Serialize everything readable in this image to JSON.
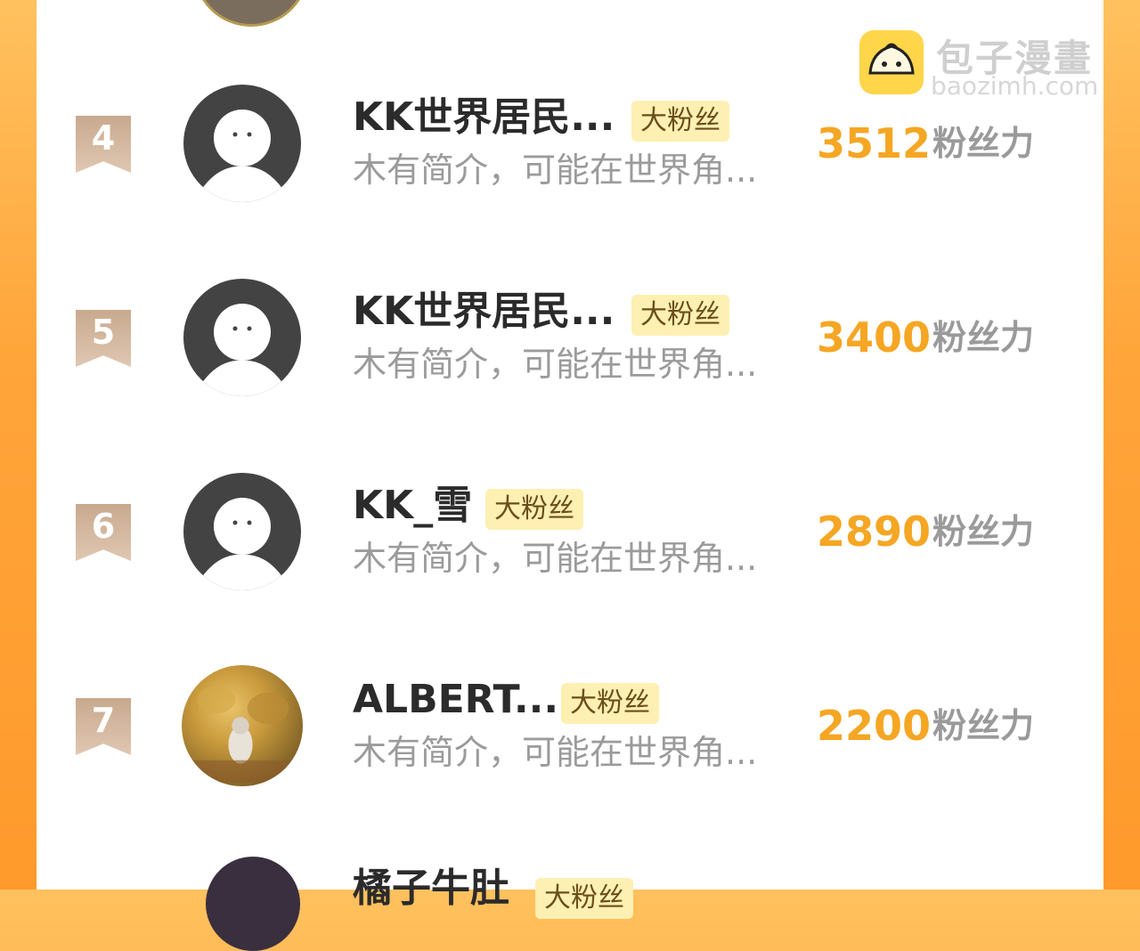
{
  "watermark": {
    "title": "包子漫畫",
    "url": "baozimh.com"
  },
  "fan_tag_label": "大粉丝",
  "score_unit": "粉丝力",
  "rows": [
    {
      "rank": "4",
      "name": "KK世界居民...",
      "bio": "木有简介，可能在世界角...",
      "score": "3512"
    },
    {
      "rank": "5",
      "name": "KK世界居民...",
      "bio": "木有简介，可能在世界角...",
      "score": "3400"
    },
    {
      "rank": "6",
      "name": "KK_雪",
      "bio": "木有简介，可能在世界角...",
      "score": "2890"
    },
    {
      "rank": "7",
      "name": "ALBERT...",
      "bio": "木有简介，可能在世界角...",
      "score": "2200"
    }
  ],
  "next_row": {
    "name": "橘子牛肚"
  },
  "colors": {
    "accent_orange": "#f5a623",
    "tag_bg": "#fdf0b2",
    "avatar_gray": "#434343",
    "frame_orange": "#ff9a2c"
  }
}
